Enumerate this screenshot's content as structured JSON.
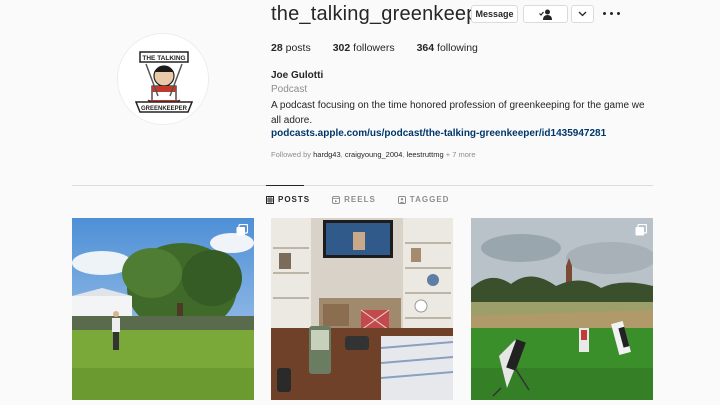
{
  "profile": {
    "username": "the_talking_greenkeeper",
    "message_label": "Message",
    "posts_count": "28",
    "posts_label": " posts",
    "followers_count": "302",
    "followers_label": " followers",
    "following_count": "364",
    "following_label": " following",
    "full_name": "Joe Gulotti",
    "category": "Podcast",
    "bio": "A podcast focusing on the time honored profession of greenkeeping for the game we all adore.",
    "link": "podcasts.apple.com/us/podcast/the-talking-greenkeeper/id1435947281",
    "followed_by_prefix": "Followed by ",
    "followed_by_users": [
      "hardg43",
      "craigyoung_2004",
      "leestruttmg"
    ],
    "followed_by_suffix": " + 7 more"
  },
  "logo": {
    "top_text": "THE TALKING",
    "bottom_text": "GREENKEEPER"
  },
  "tabs": [
    {
      "label": "POSTS",
      "icon": "grid-icon",
      "active": true
    },
    {
      "label": "REELS",
      "icon": "reels-icon",
      "active": false
    },
    {
      "label": "TAGGED",
      "icon": "tagged-icon",
      "active": false
    }
  ],
  "posts": [
    {
      "name": "golfer-putting-green-photo",
      "multi": true
    },
    {
      "name": "living-room-tv-photo",
      "multi": false
    },
    {
      "name": "golf-bags-course-photo",
      "multi": true
    }
  ],
  "colors": {
    "link": "#00376b",
    "secondary_text": "#8e8e8e",
    "background": "#fafafa"
  }
}
